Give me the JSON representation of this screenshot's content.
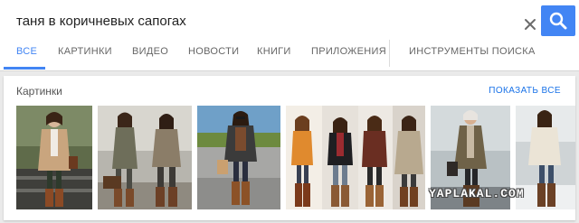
{
  "search": {
    "query": "таня в коричневых сапогах"
  },
  "tabs": [
    {
      "label": "ВСЕ",
      "active": true
    },
    {
      "label": "КАРТИНКИ",
      "active": false
    },
    {
      "label": "ВИДЕО",
      "active": false
    },
    {
      "label": "НОВОСТИ",
      "active": false
    },
    {
      "label": "КНИГИ",
      "active": false
    },
    {
      "label": "ПРИЛОЖЕНИЯ",
      "active": false
    },
    {
      "label": "ИНСТРУМЕНТЫ ПОИСКА",
      "active": false
    }
  ],
  "images_card": {
    "title": "Картинки",
    "show_all_label": "ПОКАЗАТЬ ВСЕ"
  },
  "icons": {
    "clear": "close-icon",
    "search": "search-icon"
  },
  "colors": {
    "accent": "#4285f4",
    "link": "#1a73e8"
  },
  "watermark": "YAPLAKAL.COM"
}
